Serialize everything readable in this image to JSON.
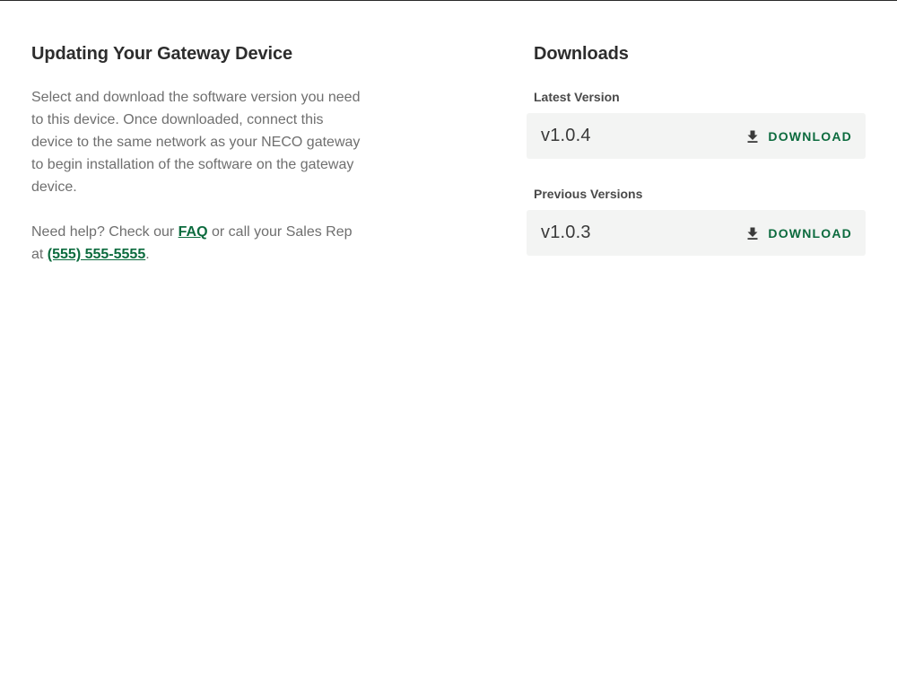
{
  "left": {
    "title": "Updating Your Gateway Device",
    "intro": "Select and download the software version you need to this device. Once downloaded, connect this device to the same network as your NECO gateway to begin installation of the software on the gateway device.",
    "help_prefix": "Need help? Check our ",
    "faq_link": "FAQ",
    "help_middle": " or call your Sales Rep at ",
    "phone_link": "(555) 555-5555",
    "help_suffix": "."
  },
  "downloads": {
    "title": "Downloads",
    "latest_label": "Latest Version",
    "latest": {
      "version": "v1.0.4",
      "button_label": "DOWNLOAD",
      "icon": "download-icon"
    },
    "previous_label": "Previous Versions",
    "previous": [
      {
        "version": "v1.0.3",
        "button_label": "DOWNLOAD",
        "icon": "download-icon"
      }
    ]
  },
  "colors": {
    "accent": "#0c6b3e",
    "row_background": "#f3f4f3",
    "body_text": "#6f6f6f",
    "heading_text": "#2d2d2d"
  }
}
